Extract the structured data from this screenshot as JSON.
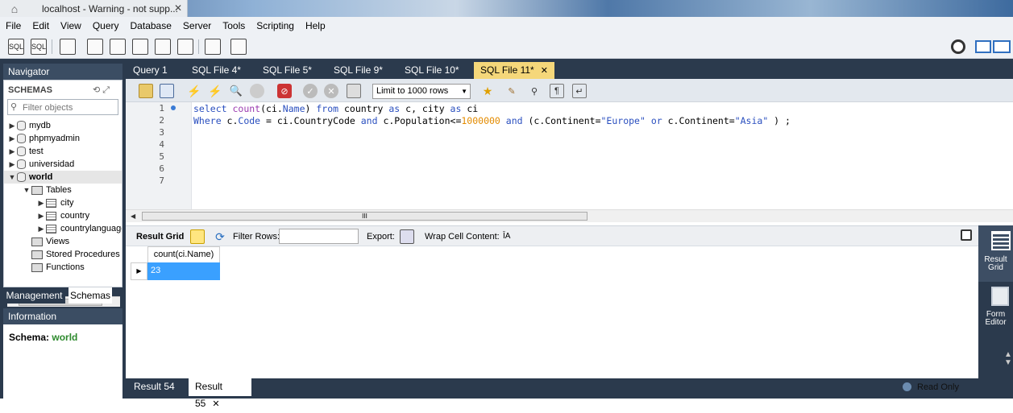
{
  "window": {
    "tab_title": "localhost - Warning - not supp...",
    "close": "✕",
    "home": "⌂"
  },
  "menu": [
    "File",
    "Edit",
    "View",
    "Query",
    "Database",
    "Server",
    "Tools",
    "Scripting",
    "Help"
  ],
  "toolbar_icons": {
    "sql_new": "SQL",
    "sql_open": "SQL"
  },
  "navigator": {
    "title": "Navigator",
    "schemas_label": "SCHEMAS",
    "filter_placeholder": "Filter objects",
    "tree": [
      {
        "label": "mydb",
        "arrow": "▶"
      },
      {
        "label": "phpmyadmin",
        "arrow": "▶"
      },
      {
        "label": "test",
        "arrow": "▶"
      },
      {
        "label": "universidad",
        "arrow": "▶"
      },
      {
        "label": "world",
        "arrow": "▼"
      },
      {
        "label": "Tables",
        "arrow": "▼"
      },
      {
        "label": "city",
        "arrow": "▶"
      },
      {
        "label": "country",
        "arrow": "▶"
      },
      {
        "label": "countrylanguage",
        "arrow": "▶"
      },
      {
        "label": "Views"
      },
      {
        "label": "Stored Procedures"
      },
      {
        "label": "Functions"
      }
    ],
    "scroll_thumb": "III"
  },
  "bottom_tabs_left": {
    "management": "Management",
    "schemas": "Schemas"
  },
  "information": {
    "title": "Information",
    "schema_label": "Schema:",
    "schema_value": "world"
  },
  "editor_tabs": [
    {
      "label": "Query 1"
    },
    {
      "label": "SQL File 4*"
    },
    {
      "label": "SQL File 5*"
    },
    {
      "label": "SQL File 9*"
    },
    {
      "label": "SQL File 10*"
    },
    {
      "label": "SQL File 11*",
      "active": true,
      "close": "✕"
    }
  ],
  "sql_toolbar": {
    "limit": "Limit to 1000 rows"
  },
  "editor": {
    "line_numbers": [
      "1",
      "2",
      "3",
      "4",
      "5",
      "6",
      "7"
    ],
    "line1": {
      "a": "select ",
      "b": "count",
      "c": "(ci.",
      "d": "Name",
      "e": ") ",
      "f": "from",
      "g": " country ",
      "h": "as",
      "i": " c, city ",
      "j": "as",
      "k": " ci"
    },
    "line2": {
      "a": "Where",
      "b": " c.",
      "c": "Code",
      "d": " = ci.CountryCode ",
      "e": "and",
      "f": " c.Population<=",
      "g": "1000000",
      "h": " ",
      "i": "and",
      "j": " (c.Continent=",
      "k": "\"Europe\"",
      "l": " ",
      "m": "or",
      "n": " c.Continent=",
      "o": "\"Asia\"",
      "p": " ) ;"
    }
  },
  "hscroll_thumb": "III",
  "result_toolbar": {
    "result_grid": "Result Grid",
    "filter_rows": "Filter Rows:",
    "export": "Export:",
    "wrap": "Wrap Cell Content:",
    "wrap_icon": "ĪA"
  },
  "grid": {
    "columns": [
      "count(ci.Name)"
    ],
    "rows": [
      [
        "23"
      ]
    ],
    "row_marker": "▶"
  },
  "right_sidebar": {
    "result_grid": "Result Grid",
    "form_editor": "Form Editor"
  },
  "bottom_tabs": {
    "result54": "Result 54",
    "result55": "Result 55",
    "close": "✕"
  },
  "status": {
    "read_only": "Read Only"
  },
  "colors": {
    "accent_tab": "#f5d77a",
    "dark_panel": "#2b3a4d",
    "selection": "#3aa0ff",
    "schema_green": "#2d8a2d"
  }
}
